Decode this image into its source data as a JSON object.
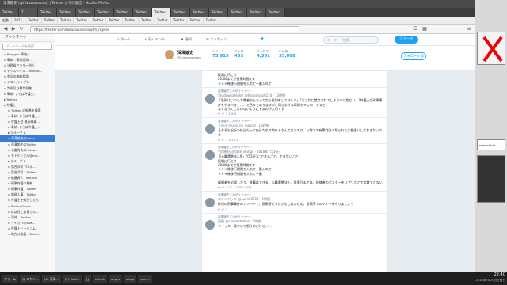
{
  "window": {
    "title": "深澤諭史 (@fukazawasato) | Twitter からの返信 - Mozilla Firefox"
  },
  "tabs": [
    "Twitter",
    "T",
    "Twitter",
    "Twitter",
    "Twitter",
    "Twitter",
    "Twitter",
    "Twitter",
    "Twitter",
    "Twitter",
    "Twitter",
    "Twitter",
    "Twitter",
    "Twitter",
    "Twitter"
  ],
  "bookmarks_bar": [
    "起動",
    "2011",
    "Twitter",
    "Twitter",
    "Twitter",
    "Twitter",
    "Twitter",
    "Twitter",
    "Twitter",
    "Twitter",
    "Twitter",
    "Twitter",
    "Twitter",
    "Twitter"
  ],
  "url": "https://twitter.com/fukazawasato/with_replies",
  "sidebar": {
    "title": "ブックマーク",
    "search_placeholder": "ブックマークを検索",
    "items": [
      "Blogger: 奉納/...",
      "奉納 - 高知県知...",
      "法務省センター防人",
      "テクスペース - Intrano...",
      "金沢の無料相談",
      "テスト/テンプレ",
      "判例及び最判例集",
      "奉納: さらば弁護士...",
      "Twitter",
      "弁護士",
      "Twitter の新着を検索",
      "奉納: さらば弁護士...",
      "弁護士会 最高検事...",
      "奉納: さらば弁護士...",
      "グループ A",
      "深澤諭史@fukaz...",
      "深澤諭史のTwitter",
      "小倉秀夫@hidea...",
      "モトケンさん@mo...",
      "グループ B",
      "落合洋司 YOUJI...",
      "落合洋司 - Twitter",
      "後藤貞人 (Twitter)",
      "刑事弁護の最新",
      "刑事弁護 - Twitter",
      "商務人事 - Twitter",
      "弁護士を処分したら",
      "Sholtz Gener...",
      "ほぼ日とお客さん...",
      "深井 - Twitter",
      "サイカバ@suw...",
      "弁護士ドットコム",
      "地方公務員 - Twitter"
    ],
    "selected_index": 15
  },
  "twitter_nav": {
    "home": "ホーム",
    "moments": "モーメント",
    "notifications": "通知",
    "messages": "メッセージ",
    "search_placeholder": "キーワード検索",
    "tweet_button": "ツイート"
  },
  "profile": {
    "name": "深澤諭史",
    "handle": "@fukazawasato",
    "stats": [
      {
        "label": "ツイート",
        "value": "73,915"
      },
      {
        "label": "フォロー",
        "value": "453"
      },
      {
        "label": "フォロワー",
        "value": "4,361"
      },
      {
        "label": "いいね",
        "value": "35,800"
      }
    ],
    "follow_button": "フォローする"
  },
  "tweets": [
    {
      "retweet_note": "",
      "author": "",
      "handle": "",
      "body": "役場に行こう\n20:00までが投票時間です\n＊＊＊株移行期間を入れて一番入れて"
    },
    {
      "retweet_note": "深澤諭史さんがリツイート",
      "author": "Shadowxampler",
      "handle": "@hanamoto0210 · 13時間",
      "body": "「私刑はいつも本職者からなってから批判をしてほしい」「どこかに論点されてしまうのは危ない」「弁護士が刑事事件をやるべき」……と色々とありますが、同じような事例をフォローすると、\nなくなってしまわないようにするのが大切です",
      "stats": "1   9   9"
    },
    {
      "retweet_note": "深澤諭史さんがリツイート",
      "author": "うのぎ",
      "handle": "@uno_no_dia2nd · 16時間",
      "body": "そもそも起訴の処分だって自分たちで取れるなんて言うのは、公判での有罪判決で取られたと勘違いしておきたいです",
      "stats": "1   5   11"
    },
    {
      "retweet_note": "深澤諭史さんがリツイート",
      "author": "竹内新伍",
      "handle": "@take_shingo · 2018年7月16日",
      "body": "【公職選挙法3.9・7月16日にできること、できないこと】\n役場に行こう\n20:00までが投票時間です\n＊＊＊株移行期間を入れて一番入れて\n＊＊＊株移行期間を入れて一番\n\n候補者を応援したり、推薦はできる。公職選挙法上、投票日までは、候補者のポスターをリプリなどで拡散できない",
      "stats": "11   1,175   1,606"
    },
    {
      "retweet_note": "深澤諭史さんがリツイート",
      "author": "スオミアッキ",
      "handle": "@suomi0728 · 1時間",
      "body": "昨日の刑事事件のナンバーで、投票所だったかもしれません。投票所でのマナーを守りましょう",
      "stats": "   "
    },
    {
      "retweet_note": "深澤諭史さんがリツイート",
      "author": "弧騎",
      "handle": "@cloverstudent · 1時間",
      "body": "ツイッター見ていて思うのだけど……",
      "stats": ""
    }
  ],
  "right_panel": {
    "thumb_label": "screenShot"
  },
  "taskbar": {
    "items": [
      "アラーム",
      "@ スクリ...",
      "(2) 深澤...",
      "(2) Twitt...",
      "[]",
      "xcleck",
      "xeyes",
      "xlogo",
      "xterm"
    ],
    "clock_time": "22:40",
    "clock_date": "2018年9月20日土曜日"
  },
  "colors": {
    "twitter_blue": "#1da1f2",
    "mark_red": "#e0245e",
    "selected_bookmark": "#3a7bd5"
  },
  "icons": [
    "home-icon",
    "lightning-icon",
    "bell-icon",
    "envelope-icon",
    "search-icon",
    "reply-icon",
    "retweet-icon",
    "heart-icon"
  ]
}
